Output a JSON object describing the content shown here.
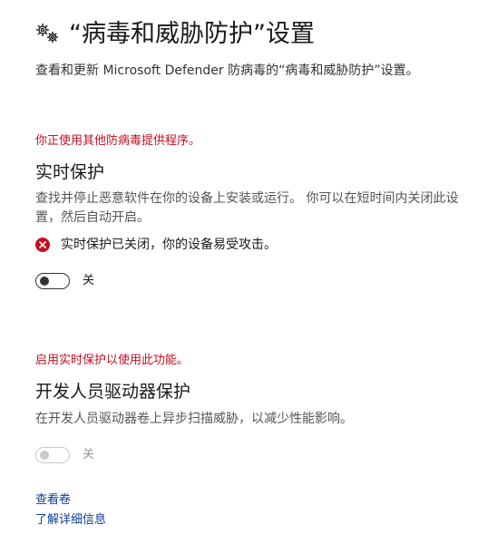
{
  "header": {
    "icon": "gears-icon",
    "title": "“病毒和威胁防护”设置",
    "subtitle": "查看和更新 Microsoft Defender 防病毒的“病毒和威胁防护”设置。"
  },
  "warning_other_provider": "你正使用其他防病毒提供程序。",
  "realtime": {
    "title": "实时保护",
    "description": "查找并停止恶意软件在你的设备上安装或运行。 你可以在短时间内关闭此设置，然后自动开启。",
    "status_icon": "error-x-icon",
    "status_text": "实时保护已关闭，你的设备易受攻击。",
    "toggle_label": "关"
  },
  "warning_enable_realtime": "启用实时保护以使用此功能。",
  "dev_drive": {
    "title": "开发人员驱动器保护",
    "description": "在开发人员驱动器卷上异步扫描威胁，以减少性能影响。",
    "toggle_label": "关"
  },
  "links": {
    "view_volumes": "查看卷",
    "learn_more": "了解详细信息"
  },
  "colors": {
    "warning": "#c50f1f",
    "link": "#0b3d91",
    "error_icon": "#c50f1f"
  }
}
